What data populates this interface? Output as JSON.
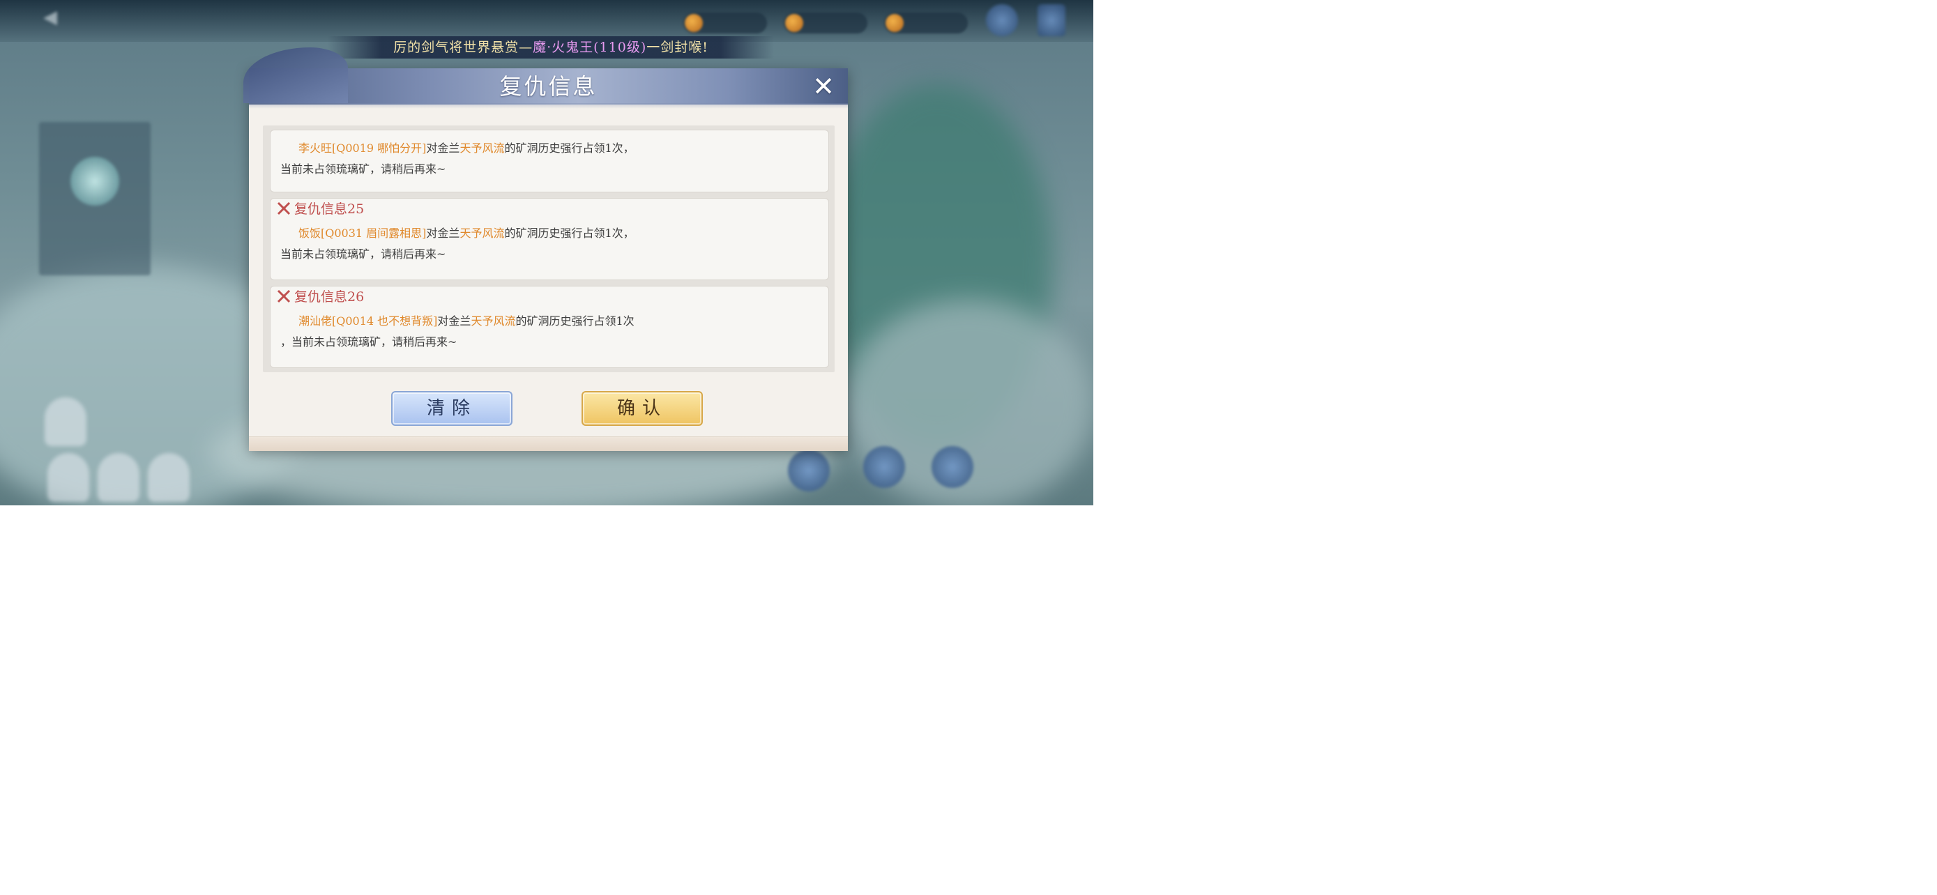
{
  "ticker": {
    "prefix": "厉的剑气将世界悬赏—",
    "boss": "魔·火鬼王(110级)",
    "suffix": "一剑封喉!"
  },
  "dialog": {
    "title": "复仇信息",
    "close_icon": "close-icon",
    "entries": [
      {
        "title": "",
        "attacker": "李火旺[Q0019 哪怕分开]",
        "mid": "对金兰",
        "target": "天予风流",
        "tail": "的矿洞历史强行占领1次，",
        "line2": "当前未占领琉璃矿，请稍后再来~"
      },
      {
        "title": "复仇信息25",
        "attacker": "饭饭[Q0031 眉间露相思]",
        "mid": "对金兰",
        "target": "天予风流",
        "tail": "的矿洞历史强行占领1次，",
        "line2": "当前未占领琉璃矿，请稍后再来~"
      },
      {
        "title": "复仇信息26",
        "attacker": "潮汕佬[Q0014 也不想背叛]",
        "mid": "对金兰",
        "target": "天予风流",
        "tail": "的矿洞历史强行占领1次",
        "line2": "，当前未占领琉璃矿，请稍后再来~"
      }
    ],
    "buttons": {
      "clear": "清除",
      "confirm": "确认"
    }
  },
  "colors": {
    "highlight": "#e0892c",
    "entry_title": "#c0504f",
    "boss_name": "#e79af0",
    "ticker_text": "#f2e2a8"
  }
}
